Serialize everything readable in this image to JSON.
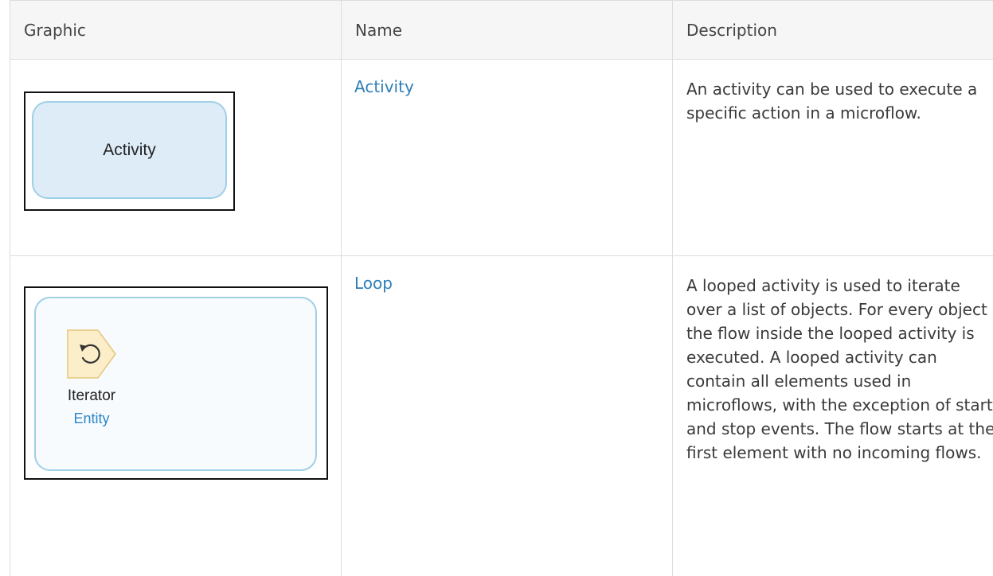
{
  "table": {
    "headers": {
      "graphic": "Graphic",
      "name": "Name",
      "description": "Description"
    },
    "rows": [
      {
        "graphic_label": "Activity",
        "name": "Activity",
        "description": "An activity can be used to execute a specific action in a microflow."
      },
      {
        "graphic_label": "Iterator",
        "graphic_sublabel": "Entity",
        "graphic_icon": "loop-iterator-icon",
        "name": "Loop",
        "description": "A looped activity is used to iterate over a list of objects. For every object the flow inside the looped activity is executed. A looped activity can contain all elements used in microflows, with the exception of start and stop events. The flow starts at the first element with no incoming flows."
      }
    ]
  },
  "colors": {
    "link": "#2f7fb6",
    "activity_fill": "#deecf8",
    "activity_border": "#9fd0e6",
    "iterator_icon_fill": "#fbeec8"
  }
}
